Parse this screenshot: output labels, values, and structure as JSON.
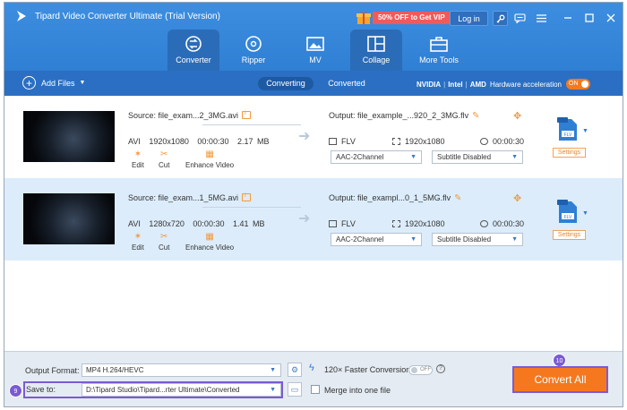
{
  "app": {
    "title": "Tipard Video Converter Ultimate (Trial Version)"
  },
  "header": {
    "promo_label": "50% OFF to Get VIP",
    "login_label": "Log in",
    "tabs": [
      {
        "label": "Converter",
        "icon": "converter-icon"
      },
      {
        "label": "Ripper",
        "icon": "ripper-icon"
      },
      {
        "label": "MV",
        "icon": "mv-icon"
      },
      {
        "label": "Collage",
        "icon": "collage-icon"
      },
      {
        "label": "More Tools",
        "icon": "toolbox-icon"
      }
    ]
  },
  "toolbar": {
    "add_files_label": "Add Files",
    "converting_label": "Converting",
    "converted_label": "Converted",
    "gpu_nvidia": "NVIDIA",
    "gpu_intel": "Intel",
    "gpu_amd": "AMD",
    "hw_accel_label": "Hardware acceleration",
    "hw_toggle": "ON"
  },
  "files": [
    {
      "source": "Source: file_exam...2_3MG.avi",
      "format": "AVI",
      "resolution": "1920x1080",
      "duration": "00:00:30",
      "size": "2.17 MB",
      "edit_label": "Edit",
      "cut_label": "Cut",
      "enhance_label": "Enhance Video",
      "output": "Output: file_example_...920_2_3MG.flv",
      "out_format": "FLV",
      "out_resolution": "1920x1080",
      "out_duration": "00:00:30",
      "audio": "AAC-2Channel",
      "subtitle": "Subtitle Disabled",
      "settings_label": "Settings"
    },
    {
      "source": "Source: file_exam...1_5MG.avi",
      "format": "AVI",
      "resolution": "1280x720",
      "duration": "00:00:30",
      "size": "1.41 MB",
      "edit_label": "Edit",
      "cut_label": "Cut",
      "enhance_label": "Enhance Video",
      "output": "Output: file_exampl...0_1_5MG.flv",
      "out_format": "FLV",
      "out_resolution": "1920x1080",
      "out_duration": "00:00:30",
      "audio": "AAC-2Channel",
      "subtitle": "Subtitle Disabled",
      "settings_label": "Settings"
    }
  ],
  "footer": {
    "output_format_label": "Output Format:",
    "output_format_value": "MP4 H.264/HEVC",
    "save_to_label": "Save to:",
    "save_to_value": "D:\\Tipard Studio\\Tipard...rter Ultimate\\Converted",
    "faster_label": "120× Faster Conversion",
    "faster_toggle": "OFF",
    "merge_label": "Merge into one file",
    "convert_all_label": "Convert All",
    "step_save": "9",
    "step_convert": "10"
  },
  "colors": {
    "accent": "#2f7fd4",
    "orange": "#f5781f",
    "annotation": "#7a5bd3"
  }
}
